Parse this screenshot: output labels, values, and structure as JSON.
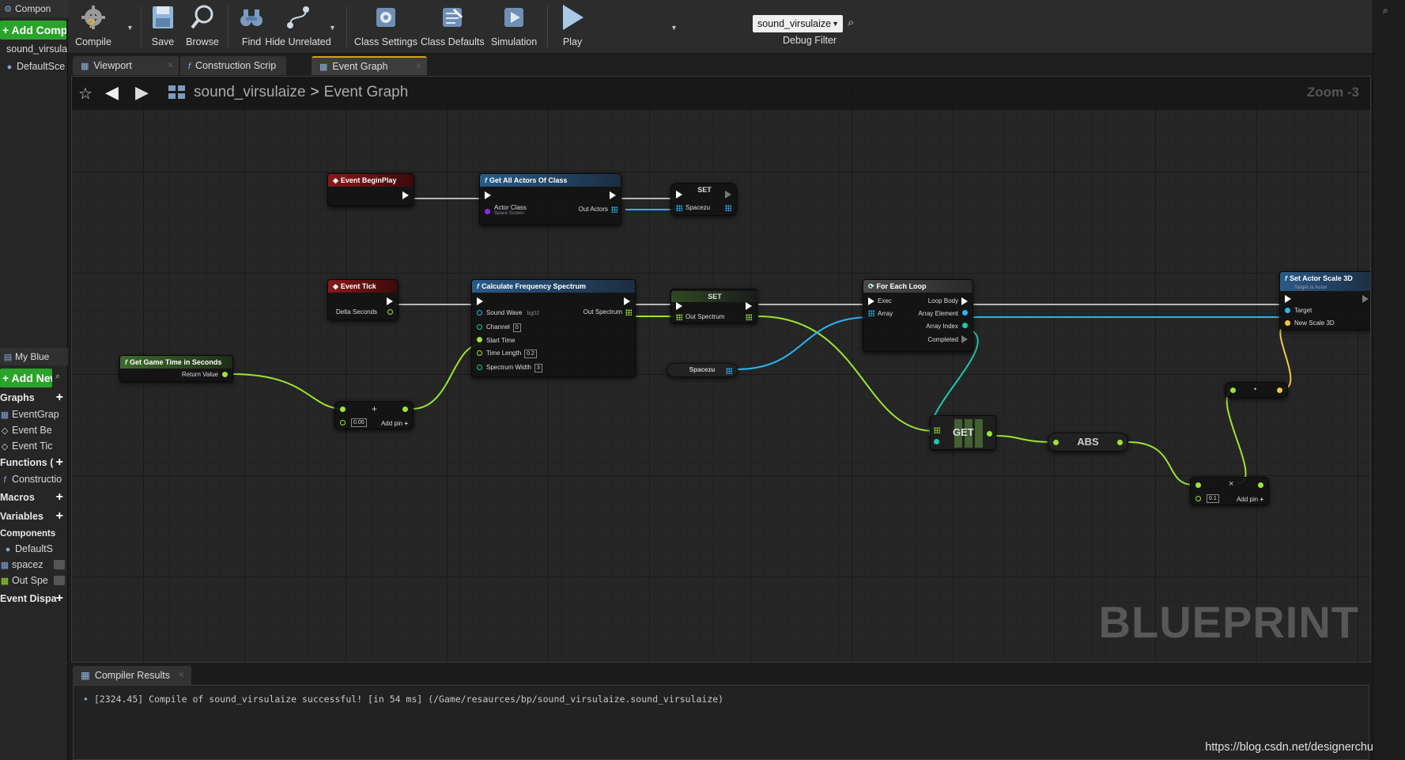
{
  "components_panel": {
    "title": "Compon",
    "add_button": "+ Add Compo",
    "items": [
      "sound_virsula",
      "DefaultSce"
    ]
  },
  "my_blueprint_panel": {
    "title": "My Blue",
    "add_new": "+ Add New",
    "sections": {
      "graphs": "Graphs",
      "functions": "Functions (",
      "macros": "Macros",
      "variables": "Variables",
      "components": "Components",
      "event_dispatchers": "Event Dispa"
    },
    "graph_items": [
      "EventGrap",
      "Event Be",
      "Event Tic"
    ],
    "function_items": [
      "Constructio"
    ],
    "component_items": [
      "DefaultS",
      "spacez",
      "Out Spe"
    ]
  },
  "toolbar": {
    "compile": "Compile",
    "save": "Save",
    "browse": "Browse",
    "find": "Find",
    "hide_unrelated": "Hide Unrelated",
    "class_settings": "Class Settings",
    "class_defaults": "Class Defaults",
    "simulation": "Simulation",
    "play": "Play",
    "debug_filter_value": "sound_virsulaize",
    "debug_filter_label": "Debug Filter"
  },
  "tabs": [
    {
      "label": "Viewport",
      "icon": "viewport-icon"
    },
    {
      "label": "Construction Scrip",
      "icon": "function-icon"
    },
    {
      "label": "Event Graph",
      "icon": "graph-icon",
      "active": true
    }
  ],
  "breadcrumb": {
    "blueprint": "sound_virsulaize",
    "graph": "Event Graph",
    "zoom": "Zoom -3"
  },
  "watermark": "BLUEPRINT",
  "nodes": {
    "begin_play": {
      "title": "Event BeginPlay"
    },
    "get_all_actors": {
      "title": "Get All Actors Of Class",
      "actor_class_label": "Actor Class",
      "actor_class_value": "Space Screen",
      "out_actors": "Out Actors"
    },
    "set1": {
      "title": "SET",
      "pin": "Spacezu"
    },
    "event_tick": {
      "title": "Event Tick",
      "delta": "Delta Seconds"
    },
    "calc_freq": {
      "title": "Calculate Frequency Spectrum",
      "sound_wave": "Sound Wave",
      "sound_wave_value": "bg02",
      "channel": "Channel",
      "channel_value": "0",
      "start_time": "Start Time",
      "time_length": "Time Length",
      "time_length_value": "0.2",
      "spectrum_width": "Spectrum Width",
      "spectrum_width_value": "3",
      "out_spectrum": "Out Spectrum"
    },
    "set2": {
      "title": "SET",
      "pin": "Out Spectrum"
    },
    "spacezu_var": {
      "title": "Spacezu"
    },
    "for_each": {
      "title": "For Each Loop",
      "exec": "Exec",
      "array": "Array",
      "loop_body": "Loop Body",
      "array_element": "Array Element",
      "array_index": "Array Index",
      "completed": "Completed"
    },
    "set_scale": {
      "title": "Set Actor Scale 3D",
      "subtitle": "Target is Actor",
      "target": "Target",
      "new_scale": "New Scale 3D"
    },
    "game_time": {
      "title": "Get Game Time in Seconds",
      "return_value": "Return Value"
    },
    "add_node": {
      "value": "0.00",
      "add_pin": "Add pin"
    },
    "get_node": {
      "title": "GET"
    },
    "abs_node": {
      "title": "ABS"
    },
    "multiply_node": {
      "value": "0.1",
      "add_pin": "Add pin",
      "symbol": "×"
    },
    "make_vector": {
      "symbol": "•"
    }
  },
  "compiler": {
    "tab": "Compiler Results",
    "message": "[2324.45] Compile of sound_virsulaize successful! [in 54 ms] (/Game/resaurces/bp/sound_virsulaize.sound_virsulaize)"
  },
  "source_url": "https://blog.csdn.net/designerchu",
  "colors": {
    "exec_wire": "#e8e8e8",
    "float_wire": "#9be534",
    "array_wire": "#29b6f6",
    "object_wire": "#1fc8a8",
    "vector_wire": "#f5c542",
    "event_header": "#8a1818",
    "function_header": "#2a5a88",
    "add_button": "#2aa32a"
  }
}
